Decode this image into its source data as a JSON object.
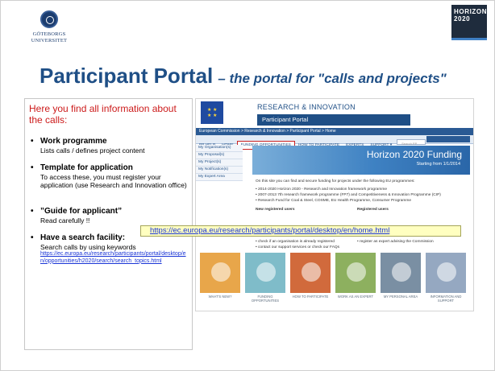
{
  "logo": {
    "text": "GÖTEBORGS UNIVERSITET"
  },
  "badge": {
    "line1": "HORIZON",
    "line2": "2020"
  },
  "title": {
    "main": "Participant Portal",
    "sub": "– the portal for \"calls and projects\""
  },
  "intro": "Here you find all information about the calls:",
  "items": [
    {
      "title": "Work programme",
      "desc": "Lists calls / defines project content"
    },
    {
      "title": "Template for application",
      "desc": "To access these, you must register your application (use Research and Innovation  office)"
    },
    {
      "title": "”Guide for applicant”",
      "desc": "Read carefully !!"
    },
    {
      "title": "Have a search facility:",
      "desc": "Search calls by using keywords",
      "link": "https://ec.europa.eu/research/participants/portal/desktop/en/opportunities/h2020/search/search_topics.html"
    }
  ],
  "url_box": "https://ec.europa.eu/research/participants/portal/desktop/en/home.html",
  "screenshot": {
    "header": "RESEARCH & INNOVATION",
    "subheader": "Participant Portal",
    "breadcrumb": "European Commission > Research & Innovation > Participant Portal > Home",
    "nav": [
      "PP HELP",
      "HOME",
      "FUNDING OPPORTUNITIES",
      "HOW TO PARTICIPATE",
      "EXPERTS",
      "SUPPORT ▾"
    ],
    "search_placeholder": "Search PP",
    "left_nav": [
      "My Organisation(s)",
      "My Proposal(s)",
      "My Project(s)",
      "My Notification(s)",
      "My Expert Area"
    ],
    "banner_title": "Horizon 2020 Funding",
    "banner_sub": "Starting from 1/1/2014",
    "paragraph": "On this site you can find and secure funding for projects under the following EU programmes:",
    "bullets": [
      "• 2014-2020 Horizon 2020 - Research and Innovation framework programme",
      "• 2007-2013 7th research framework programme (FP7) and Competitiveness & Innovation Programme (CIP)",
      "• Research Fund for Coal & Steel, COSME, EU Health Programme, Consumer Programme"
    ],
    "new_users": "New registered users",
    "registered_users": "Registered users",
    "footer_bullets": [
      "• check if an organisation is already registered",
      "• register as expert advising the Commission",
      "• contact our support services or check our FAQs"
    ],
    "tiles": [
      {
        "caption": "WHAT'S NEW?",
        "color": "#e8a64a"
      },
      {
        "caption": "FUNDING OPPORTUNITIES",
        "color": "#7fbcc9"
      },
      {
        "caption": "HOW TO PARTICIPATE",
        "color": "#d16a3c"
      },
      {
        "caption": "WORK AS AN EXPERT",
        "color": "#8db05f"
      },
      {
        "caption": "MY PERSONAL AREA",
        "color": "#7a8fa3"
      },
      {
        "caption": "INFORMATION AND SUPPORT",
        "color": "#95a8c1"
      }
    ]
  }
}
